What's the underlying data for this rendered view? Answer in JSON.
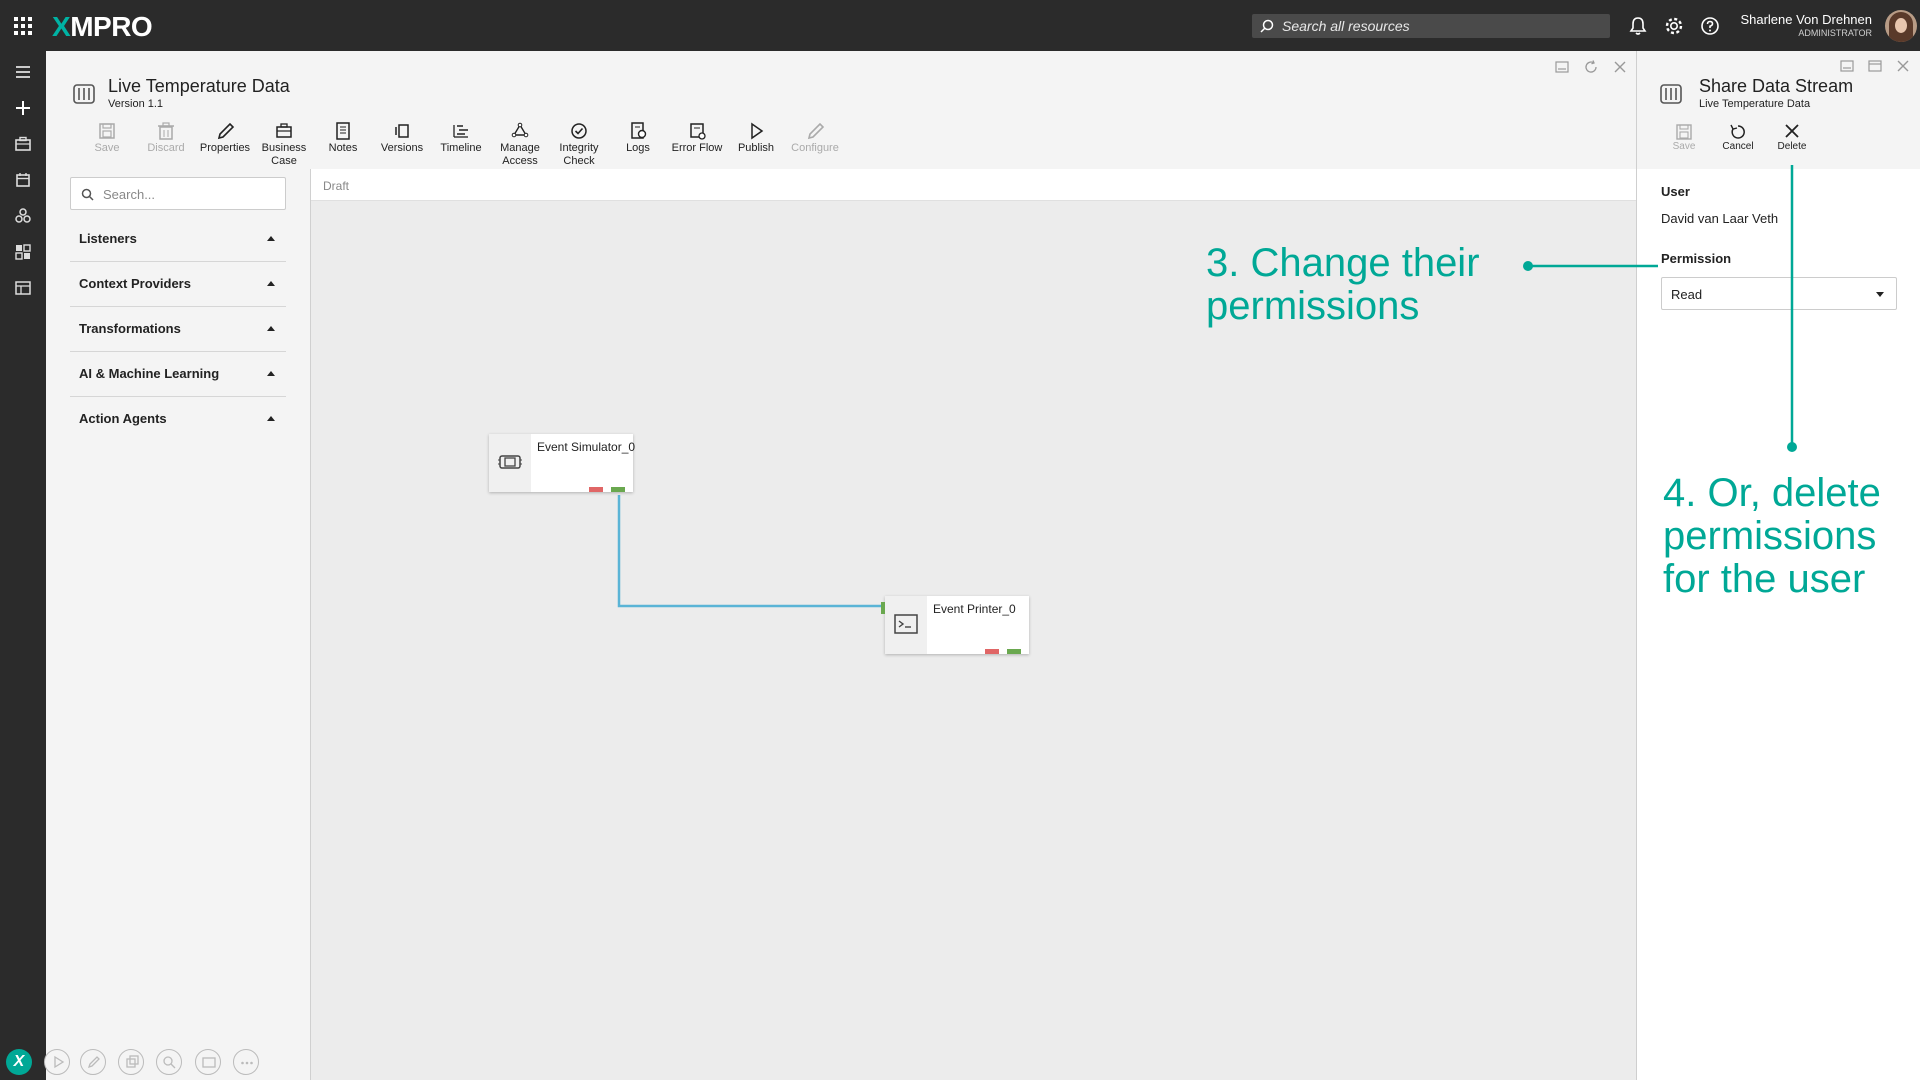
{
  "brand": {
    "logo": "XMPRO",
    "accent": "#00a896"
  },
  "header": {
    "search_placeholder": "Search all resources",
    "user_name": "Sharlene Von Drehnen",
    "user_role": "ADMINISTRATOR",
    "icons": [
      "apps-grid-icon",
      "bell-icon",
      "gear-icon",
      "help-icon"
    ]
  },
  "left_rail": {
    "icons": [
      "menu-icon",
      "plus-icon",
      "briefcase-icon",
      "calendar-icon",
      "agents-icon",
      "dashboard-icon",
      "table-icon"
    ]
  },
  "main": {
    "title": "Live Temperature Data",
    "version": "Version 1.1",
    "toolbar": [
      {
        "label": "Save",
        "icon": "save-icon",
        "disabled": true
      },
      {
        "label": "Discard",
        "icon": "trash-icon",
        "disabled": true
      },
      {
        "label": "Properties",
        "icon": "pencil-icon",
        "disabled": false
      },
      {
        "label": "Business Case",
        "icon": "business-case-icon",
        "disabled": false
      },
      {
        "label": "Notes",
        "icon": "notes-icon",
        "disabled": false
      },
      {
        "label": "Versions",
        "icon": "versions-icon",
        "disabled": false
      },
      {
        "label": "Timeline",
        "icon": "timeline-icon",
        "disabled": false
      },
      {
        "label": "Manage Access",
        "icon": "manage-access-icon",
        "disabled": false
      },
      {
        "label": "Integrity Check",
        "icon": "check-circle-icon",
        "disabled": false
      },
      {
        "label": "Logs",
        "icon": "logs-icon",
        "disabled": false
      },
      {
        "label": "Error Flow",
        "icon": "error-flow-icon",
        "disabled": false
      },
      {
        "label": "Publish",
        "icon": "play-icon",
        "disabled": false
      },
      {
        "label": "Configure",
        "icon": "pencil-icon",
        "disabled": true
      }
    ],
    "library": {
      "search_placeholder": "Search...",
      "categories": [
        "Listeners",
        "Context Providers",
        "Transformations",
        "AI & Machine Learning",
        "Action Agents"
      ]
    },
    "canvas": {
      "status": "Draft",
      "nodes": [
        {
          "label": "Event Simulator_0",
          "icon": "simulator-icon"
        },
        {
          "label": "Event Printer_0",
          "icon": "terminal-icon"
        }
      ],
      "connector_color": "#5ab4d6"
    }
  },
  "share_panel": {
    "title": "Share Data Stream",
    "subtitle": "Live Temperature Data",
    "actions": [
      {
        "label": "Save",
        "icon": "save-icon",
        "disabled": true
      },
      {
        "label": "Cancel",
        "icon": "undo-icon",
        "disabled": false
      },
      {
        "label": "Delete",
        "icon": "close-icon",
        "disabled": false
      }
    ],
    "user_label": "User",
    "user_value": "David van Laar Veth",
    "permission_label": "Permission",
    "permission_value": "Read"
  },
  "annotations": {
    "step3": [
      "3. Change their",
      "permissions"
    ],
    "step4": [
      "4. Or, delete",
      "permissions",
      "for the user"
    ]
  }
}
